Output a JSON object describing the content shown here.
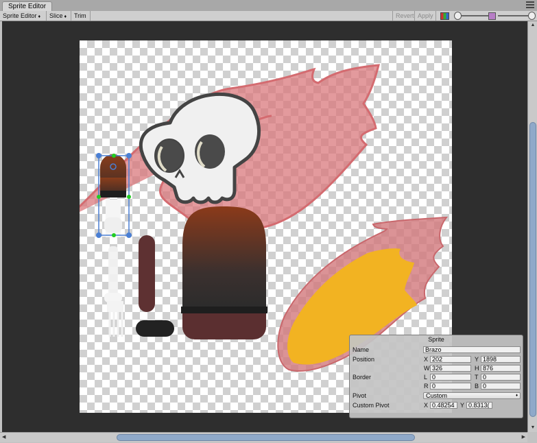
{
  "window": {
    "tab_title": "Sprite Editor"
  },
  "toolbar": {
    "mode_label": "Sprite Editor",
    "slice_label": "Slice",
    "trim_label": "Trim",
    "revert_label": "Revert",
    "apply_label": "Apply"
  },
  "sprite_panel": {
    "title": "Sprite",
    "name_label": "Name",
    "name_value": "Brazo",
    "position_label": "Position",
    "pos_x_axis": "X",
    "pos_x": "202",
    "pos_y_axis": "Y",
    "pos_y": "1898",
    "pos_w_axis": "W",
    "pos_w": "326",
    "pos_h_axis": "H",
    "pos_h": "876",
    "border_label": "Border",
    "border_l_axis": "L",
    "border_l": "0",
    "border_t_axis": "T",
    "border_t": "0",
    "border_r_axis": "R",
    "border_r": "0",
    "border_b_axis": "B",
    "border_b": "0",
    "pivot_label": "Pivot",
    "pivot_value": "Custom",
    "custom_pivot_label": "Custom Pivot",
    "cp_x_axis": "X",
    "cp_x": "0.48254",
    "cp_y_axis": "Y",
    "cp_y": "0.8313("
  },
  "colors": {
    "viewport_bg": "#2e2e2e",
    "selection_outline": "#4a7fd4",
    "handle_green": "#22cc22",
    "flame_fill": "#f2b322",
    "flame_outline": "#c9676c"
  }
}
